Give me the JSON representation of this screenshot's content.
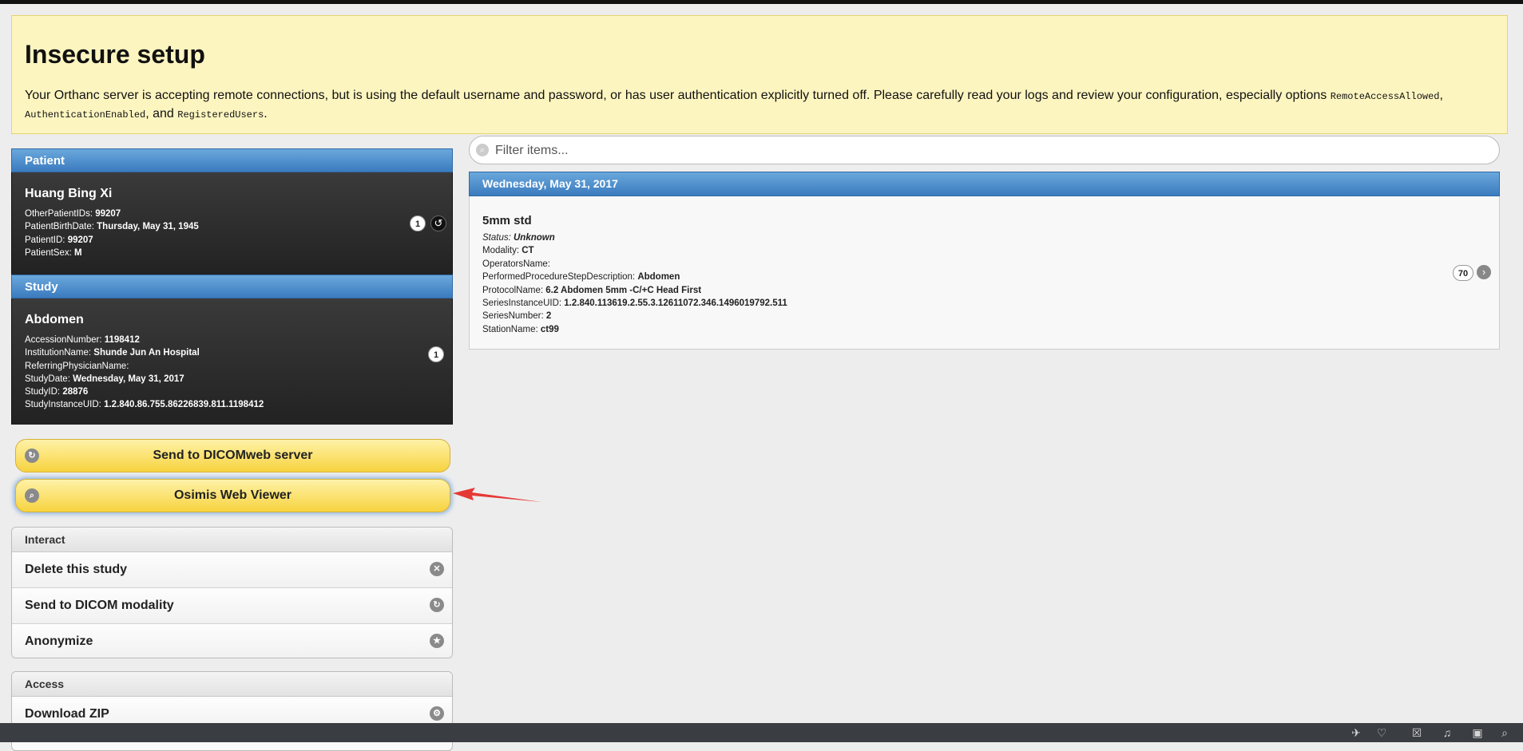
{
  "banner": {
    "title": "Insecure setup",
    "message_start": "Your Orthanc server is accepting remote connections, but is using the default username and password, or has user authentication explicitly turned off. Please carefully read your logs and review your configuration, especially options ",
    "opt1": "RemoteAccessAllowed",
    "sep1": ",",
    "opt2": "AuthenticationEnabled",
    "sep2": ", and ",
    "opt3": "RegisteredUsers",
    "end": "."
  },
  "patient": {
    "header": "Patient",
    "name": "Huang Bing Xi",
    "fields": [
      {
        "k": "OtherPatientIDs: ",
        "v": "99207"
      },
      {
        "k": "PatientBirthDate: ",
        "v": "Thursday, May 31, 1945"
      },
      {
        "k": "PatientID: ",
        "v": "99207"
      },
      {
        "k": "PatientSex: ",
        "v": "M"
      }
    ],
    "count": "1"
  },
  "study": {
    "header": "Study",
    "name": "Abdomen",
    "fields": [
      {
        "k": "AccessionNumber: ",
        "v": "1198412"
      },
      {
        "k": "InstitutionName: ",
        "v": "Shunde Jun An Hospital"
      },
      {
        "k": "ReferringPhysicianName: ",
        "v": ""
      },
      {
        "k": "StudyDate: ",
        "v": "Wednesday, May 31, 2017"
      },
      {
        "k": "StudyID: ",
        "v": "28876"
      },
      {
        "k": "StudyInstanceUID: ",
        "v": "1.2.840.86.755.86226839.811.1198412"
      }
    ],
    "count": "1"
  },
  "buttons": {
    "send_dicomweb": "Send to DICOMweb server",
    "osimis": "Osimis Web Viewer"
  },
  "interact": {
    "header": "Interact",
    "items": [
      "Delete this study",
      "Send to DICOM modality",
      "Anonymize"
    ]
  },
  "access": {
    "header": "Access",
    "items": [
      "Download ZIP"
    ]
  },
  "filter": {
    "placeholder": "Filter items..."
  },
  "series_list": {
    "date_header": "Wednesday, May 31, 2017",
    "series": {
      "title": "5mm std",
      "status_label": "Status: ",
      "status_value": "Unknown",
      "fields": [
        {
          "k": "Modality: ",
          "v": "CT"
        },
        {
          "k": "OperatorsName: ",
          "v": ""
        },
        {
          "k": "PerformedProcedureStepDescription: ",
          "v": "Abdomen"
        },
        {
          "k": "ProtocolName: ",
          "v": "6.2 Abdomen 5mm -C/+C Head First"
        },
        {
          "k": "SeriesInstanceUID: ",
          "v": "1.2.840.113619.2.55.3.12611072.346.1496019792.511"
        },
        {
          "k": "SeriesNumber: ",
          "v": "2"
        },
        {
          "k": "StationName: ",
          "v": "ct99"
        }
      ],
      "count": "70"
    }
  },
  "colors": {
    "banner_bg": "#fdf5c0",
    "header_blue": "#3b7bbf",
    "button_yellow": "#f7d33f",
    "annotation_red": "#e53935"
  },
  "taskbar": {
    "icons": [
      "rocket-icon",
      "heart-monitor-icon",
      "trash-icon",
      "speaker-icon",
      "window-icon",
      "search-icon"
    ]
  }
}
